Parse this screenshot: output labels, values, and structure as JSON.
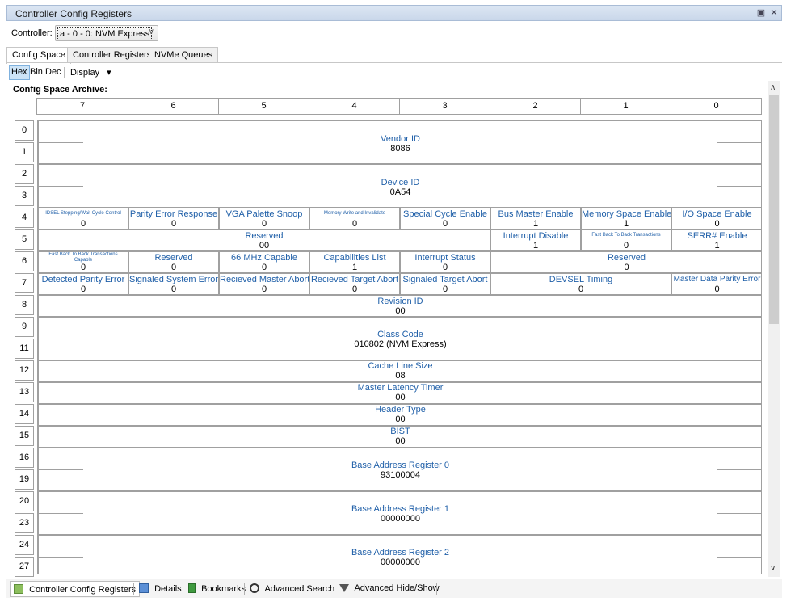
{
  "window": {
    "title": "Controller Config Registers",
    "restore_icon": "restore-icon",
    "close_icon": "close-icon",
    "restore_glyph": "▣",
    "close_glyph": "✕"
  },
  "controller": {
    "label": "Controller:",
    "selected": "a - 0 - 0: NVM Express",
    "arrow": "∨"
  },
  "tabs": [
    {
      "label": "Config Space",
      "active": true
    },
    {
      "label": "Controller Registers",
      "active": false
    },
    {
      "label": "NVMe Queues",
      "active": false
    }
  ],
  "toolbar": {
    "hex": "Hex",
    "bin": "Bin",
    "dec": "Dec",
    "display": "Display",
    "display_arrow": "▾"
  },
  "archive_title": "Config Space Archive:",
  "bit_headers": [
    "7",
    "6",
    "5",
    "4",
    "3",
    "2",
    "1",
    "0"
  ],
  "row_labels": [
    "0",
    "1",
    "2",
    "3",
    "4",
    "5",
    "6",
    "7",
    "8",
    "9",
    "11",
    "12",
    "13",
    "14",
    "15",
    "16",
    "19",
    "20",
    "23",
    "24",
    "27"
  ],
  "fields": {
    "vendor_id": {
      "name": "Vendor ID",
      "value": "8086"
    },
    "device_id": {
      "name": "Device ID",
      "value": "0A54"
    },
    "r4": [
      {
        "name": "IDSEL Stepping/Wait Cycle Control",
        "value": "0"
      },
      {
        "name": "Parity Error Response",
        "value": "0"
      },
      {
        "name": "VGA Palette Snoop",
        "value": "0"
      },
      {
        "name": "Memory Write and Invalidate",
        "value": "0"
      },
      {
        "name": "Special Cycle Enable",
        "value": "0"
      },
      {
        "name": "Bus Master Enable",
        "value": "1"
      },
      {
        "name": "Memory Space Enable",
        "value": "1"
      },
      {
        "name": "I/O Space Enable",
        "value": "0"
      }
    ],
    "r5_reserved": {
      "name": "Reserved",
      "value": "00"
    },
    "r5": [
      {
        "name": "Interrupt Disable",
        "value": "1"
      },
      {
        "name": "Fast Back To Back Transactions",
        "value": "0"
      },
      {
        "name": "SERR# Enable",
        "value": "1"
      }
    ],
    "r6": [
      {
        "name": "Fast Back To Back Transactions Capable",
        "value": "0"
      },
      {
        "name": "Reserved",
        "value": "0"
      },
      {
        "name": "66 MHz Capable",
        "value": "0"
      },
      {
        "name": "Capabilities List",
        "value": "1"
      },
      {
        "name": "Interrupt Status",
        "value": "0"
      }
    ],
    "r6_reserved": {
      "name": "Reserved",
      "value": "0"
    },
    "r7": [
      {
        "name": "Detected Parity Error",
        "value": "0"
      },
      {
        "name": "Signaled System Error",
        "value": "0"
      },
      {
        "name": "Recieved Master Abort",
        "value": "0"
      },
      {
        "name": "Recieved Target Abort",
        "value": "0"
      },
      {
        "name": "Signaled Target Abort",
        "value": "0"
      }
    ],
    "devsel": {
      "name": "DEVSEL Timing",
      "value": "0"
    },
    "master_parity": {
      "name": "Master Data Parity Error",
      "value": "0"
    },
    "revision_id": {
      "name": "Revision ID",
      "value": "00"
    },
    "class_code": {
      "name": "Class Code",
      "value": "010802 (NVM Express)"
    },
    "cache_line": {
      "name": "Cache Line Size",
      "value": "08"
    },
    "latency": {
      "name": "Master Latency Timer",
      "value": "00"
    },
    "header_type": {
      "name": "Header Type",
      "value": "00"
    },
    "bist": {
      "name": "BIST",
      "value": "00"
    },
    "bar0": {
      "name": "Base Address Register 0",
      "value": "93100004"
    },
    "bar1": {
      "name": "Base Address Register 1",
      "value": "00000000"
    },
    "bar2": {
      "name": "Base Address Register 2",
      "value": "00000000"
    }
  },
  "bottom_tabs": [
    {
      "label": "Controller Config Registers",
      "icon": "table-icon",
      "active": true
    },
    {
      "label": "Details",
      "icon": "details-icon",
      "active": false
    },
    {
      "label": "Bookmarks",
      "icon": "bookmark-icon",
      "active": false
    },
    {
      "label": "Advanced Search",
      "icon": "binoculars-icon",
      "active": false
    },
    {
      "label": "Advanced Hide/Show",
      "icon": "filter-icon",
      "active": false
    }
  ],
  "colors": {
    "field_name": "#1f5fa8",
    "grid": "#a0a0a0",
    "title_bg": "#dce6f3",
    "selected_tb": "#cde4f7"
  }
}
